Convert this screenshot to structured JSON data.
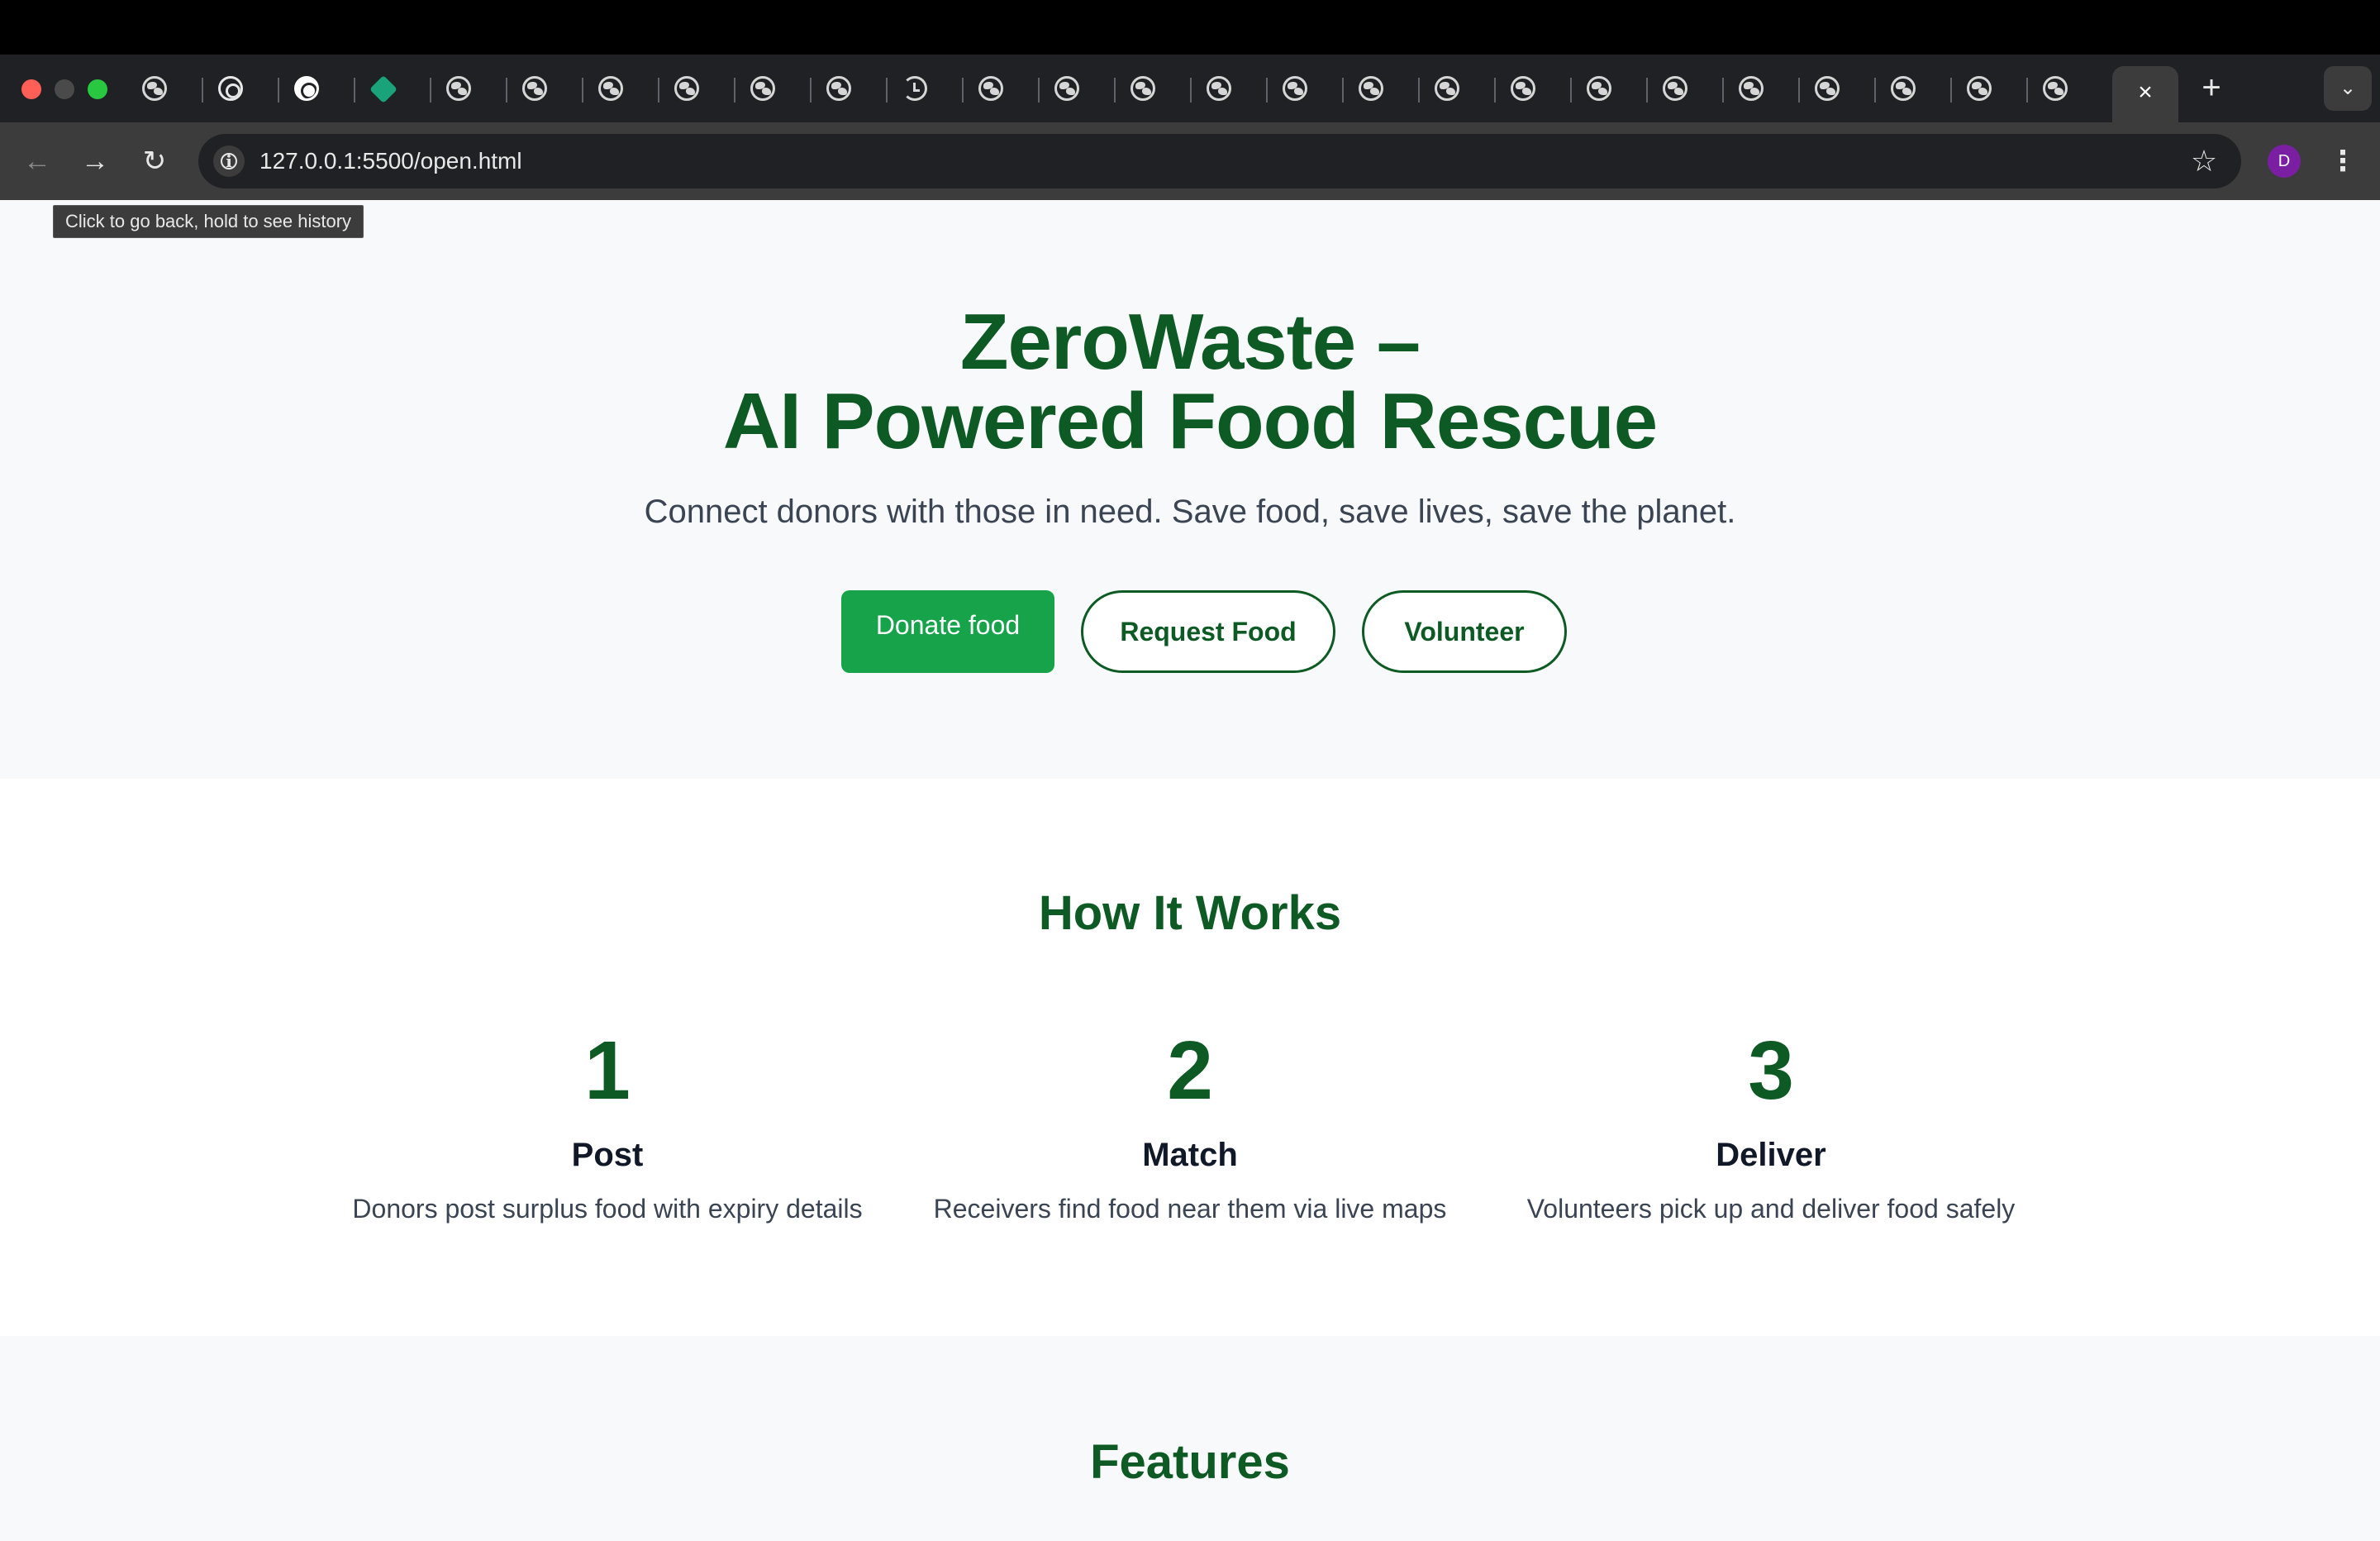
{
  "browser": {
    "url": "127.0.0.1:5500/open.html",
    "active_tab_close": "×",
    "new_tab": "+",
    "tab_menu": "⌄",
    "back_icon": "←",
    "forward_icon": "→",
    "reload_icon": "↻",
    "bookmark_icon": "☆",
    "profile_initial": "D",
    "menu_icon": "⋮",
    "tooltip": "Click to go back, hold to see history",
    "tabs": [
      {
        "icon": "globe-icon"
      },
      {
        "icon": "openai-icon"
      },
      {
        "icon": "openai-icon"
      },
      {
        "icon": "diamond-icon"
      },
      {
        "icon": "globe-icon"
      },
      {
        "icon": "globe-icon"
      },
      {
        "icon": "globe-icon"
      },
      {
        "icon": "globe-icon"
      },
      {
        "icon": "globe-icon"
      },
      {
        "icon": "globe-icon"
      },
      {
        "icon": "history-icon"
      },
      {
        "icon": "globe-icon"
      },
      {
        "icon": "globe-icon"
      },
      {
        "icon": "globe-icon"
      },
      {
        "icon": "globe-icon"
      },
      {
        "icon": "globe-icon"
      },
      {
        "icon": "globe-icon"
      },
      {
        "icon": "globe-icon"
      },
      {
        "icon": "globe-icon"
      },
      {
        "icon": "globe-icon"
      },
      {
        "icon": "globe-icon"
      },
      {
        "icon": "globe-icon"
      },
      {
        "icon": "globe-icon"
      },
      {
        "icon": "globe-icon"
      },
      {
        "icon": "globe-icon"
      },
      {
        "icon": "globe-icon"
      }
    ]
  },
  "hero": {
    "title_line1": "ZeroWaste –",
    "title_line2": "AI Powered Food Rescue",
    "subtitle": "Connect donors with those in need. Save food, save lives, save the planet.",
    "buttons": {
      "donate": "Donate food",
      "request": "Request Food",
      "volunteer": "Volunteer"
    }
  },
  "how_it_works": {
    "title": "How It Works",
    "steps": [
      {
        "number": "1",
        "title": "Post",
        "description": "Donors post surplus food with expiry details"
      },
      {
        "number": "2",
        "title": "Match",
        "description": "Receivers find food near them via live maps"
      },
      {
        "number": "3",
        "title": "Deliver",
        "description": "Volunteers pick up and deliver food safely"
      }
    ]
  },
  "features": {
    "title": "Features"
  },
  "colors": {
    "brand_green": "#0e5a24",
    "button_green": "#16a34a",
    "hero_bg": "#f8f9fa",
    "chrome_dark": "#202124"
  }
}
